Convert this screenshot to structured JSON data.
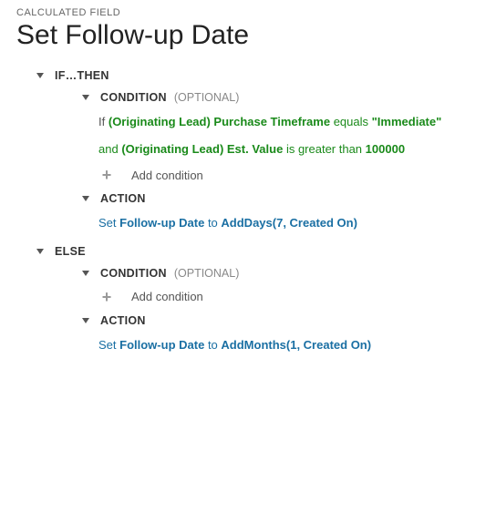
{
  "header": {
    "eyebrow": "CALCULATED FIELD",
    "title": "Set Follow-up Date"
  },
  "labels": {
    "if_then": "IF…THEN",
    "else": "ELSE",
    "condition": "CONDITION",
    "optional": "(OPTIONAL)",
    "action": "ACTION",
    "add_condition": "Add condition"
  },
  "if_branch": {
    "conditions": {
      "line1": {
        "prefix": "If",
        "field": "(Originating Lead) Purchase Timeframe",
        "operator": "equals",
        "value": "\"Immediate\""
      },
      "line2": {
        "prefix": "and",
        "field": "(Originating Lead) Est. Value",
        "operator": "is greater than",
        "value": "100000"
      }
    },
    "action": {
      "prefix": "Set",
      "field": "Follow-up Date",
      "to": "to",
      "formula": "AddDays(7, Created On)"
    }
  },
  "else_branch": {
    "action": {
      "prefix": "Set",
      "field": "Follow-up Date",
      "to": "to",
      "formula": "AddMonths(1, Created On)"
    }
  }
}
